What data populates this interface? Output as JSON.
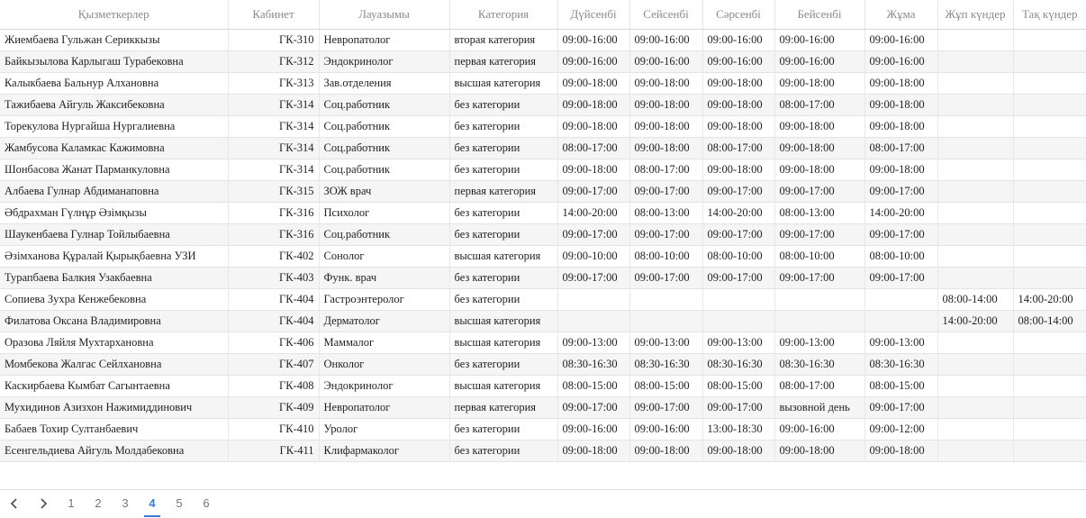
{
  "columns": [
    "Қызметкерлер",
    "Кабинет",
    "Лауазымы",
    "Категория",
    "Дүйсенбі",
    "Сейсенбі",
    "Сәрсенбі",
    "Бейсенбі",
    "Жұма",
    "Жұп күндер",
    "Тақ күндер"
  ],
  "rows": [
    [
      "Жиембаева Гульжан Сериккызы",
      "ГК-310",
      "Невропатолог",
      "вторая категория",
      "09:00-16:00",
      "09:00-16:00",
      "09:00-16:00",
      "09:00-16:00",
      "09:00-16:00",
      "",
      ""
    ],
    [
      "Байкызылова Карлыгаш Турабековна",
      "ГК-312",
      "Эндокринолог",
      "первая категория",
      "09:00-16:00",
      "09:00-16:00",
      "09:00-16:00",
      "09:00-16:00",
      "09:00-16:00",
      "",
      ""
    ],
    [
      "Калыкбаева Бальнур Алхановна",
      "ГК-313",
      "Зав.отделения",
      "высшая категория",
      "09:00-18:00",
      "09:00-18:00",
      "09:00-18:00",
      "09:00-18:00",
      "09:00-18:00",
      "",
      ""
    ],
    [
      "Тажибаева Айгуль Жаксибековна",
      "ГК-314",
      "Соц.работник",
      "без категории",
      "09:00-18:00",
      "09:00-18:00",
      "09:00-18:00",
      "08:00-17:00",
      "09:00-18:00",
      "",
      ""
    ],
    [
      "Торекулова Нургайша Нургалиевна",
      "ГК-314",
      "Соц.работник",
      "без категории",
      "09:00-18:00",
      "09:00-18:00",
      "09:00-18:00",
      "09:00-18:00",
      "09:00-18:00",
      "",
      ""
    ],
    [
      "Жамбусова Каламкас Кажимовна",
      "ГК-314",
      "Соц.работник",
      "без категории",
      "08:00-17:00",
      "09:00-18:00",
      "08:00-17:00",
      "09:00-18:00",
      "08:00-17:00",
      "",
      ""
    ],
    [
      "Шонбасова Жанат Парманкуловна",
      "ГК-314",
      "Соц.работник",
      "без категории",
      "09:00-18:00",
      "08:00-17:00",
      "09:00-18:00",
      "09:00-18:00",
      "09:00-18:00",
      "",
      ""
    ],
    [
      "Албаева Гулнар Абдиманаповна",
      "ГК-315",
      "ЗОЖ врач",
      "первая категория",
      "09:00-17:00",
      "09:00-17:00",
      "09:00-17:00",
      "09:00-17:00",
      "09:00-17:00",
      "",
      ""
    ],
    [
      "Әбдрахман Гүлнұр Әзімқызы",
      "ГК-316",
      "Психолог",
      "без категории",
      "14:00-20:00",
      "08:00-13:00",
      "14:00-20:00",
      "08:00-13:00",
      "14:00-20:00",
      "",
      ""
    ],
    [
      "Шаукенбаева Гулнар Тойлыбаевна",
      "ГК-316",
      "Соц.работник",
      "без категории",
      "09:00-17:00",
      "09:00-17:00",
      "09:00-17:00",
      "09:00-17:00",
      "09:00-17:00",
      "",
      ""
    ],
    [
      "Әзімханова Құралай Қырықбаевна УЗИ",
      "ГК-402",
      "Сонолог",
      "высшая категория",
      "09:00-10:00",
      "08:00-10:00",
      "08:00-10:00",
      "08:00-10:00",
      "08:00-10:00",
      "",
      ""
    ],
    [
      "Турапбаева Балкия Узакбаевна",
      "ГК-403",
      "Функ. врач",
      "без категории",
      "09:00-17:00",
      "09:00-17:00",
      "09:00-17:00",
      "09:00-17:00",
      "09:00-17:00",
      "",
      ""
    ],
    [
      "Сопиева Зухра Кенжебековна",
      "ГК-404",
      "Гастроэнтеролог",
      "без категории",
      "",
      "",
      "",
      "",
      "",
      "08:00-14:00",
      "14:00-20:00"
    ],
    [
      "Филатова Оксана Владимировна",
      "ГК-404",
      "Дерматолог",
      "высшая категория",
      "",
      "",
      "",
      "",
      "",
      "14:00-20:00",
      "08:00-14:00"
    ],
    [
      "Оразова Ляйля Мухтархановна",
      "ГК-406",
      "Маммалог",
      "высшая категория",
      "09:00-13:00",
      "09:00-13:00",
      "09:00-13:00",
      "09:00-13:00",
      "09:00-13:00",
      "",
      ""
    ],
    [
      "Момбекова Жалгас Сейлхановна",
      "ГК-407",
      "Онколог",
      "без категории",
      "08:30-16:30",
      "08:30-16:30",
      "08:30-16:30",
      "08:30-16:30",
      "08:30-16:30",
      "",
      ""
    ],
    [
      "Каскирбаева Кымбат Сагынтаевна",
      "ГК-408",
      "Эндокринолог",
      "высшая категория",
      "08:00-15:00",
      "08:00-15:00",
      "08:00-15:00",
      "08:00-17:00",
      "08:00-15:00",
      "",
      ""
    ],
    [
      "Мухидинов Азизхон Нажимиддинович",
      "ГК-409",
      "Невропатолог",
      "первая категория",
      "09:00-17:00",
      "09:00-17:00",
      "09:00-17:00",
      "вызовной день",
      "09:00-17:00",
      "",
      ""
    ],
    [
      "Бабаев Тохир Султанбаевич",
      "ГК-410",
      "Уролог",
      "без категории",
      "09:00-16:00",
      "09:00-16:00",
      "13:00-18:30",
      "09:00-16:00",
      "09:00-12:00",
      "",
      ""
    ],
    [
      "Есенгельдиева Айгуль Молдабековна",
      "ГК-411",
      "Клифармаколог",
      "без категории",
      "09:00-18:00",
      "09:00-18:00",
      "09:00-18:00",
      "09:00-18:00",
      "09:00-18:00",
      "",
      ""
    ]
  ],
  "pagination": {
    "prev_icon": "chevron-left-icon",
    "next_icon": "chevron-right-icon",
    "pages": [
      "1",
      "2",
      "3",
      "4",
      "5",
      "6"
    ],
    "current": "4",
    "accent": "#3a7bd5"
  }
}
